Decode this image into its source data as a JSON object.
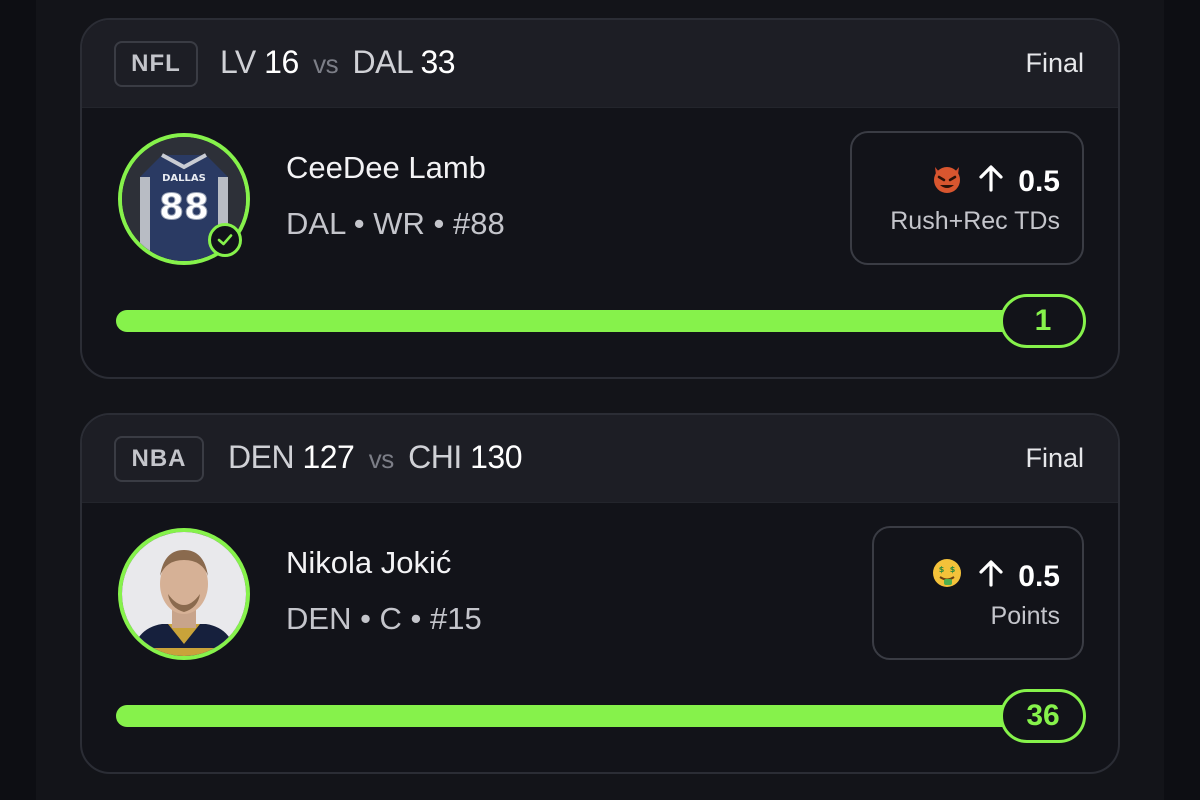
{
  "colors": {
    "accent": "#86f24b",
    "background": "#0d0e13",
    "card": "#121319",
    "header": "#1d1e25"
  },
  "cards": [
    {
      "league": "NFL",
      "team1": "LV",
      "score1": "16",
      "vs": "vs",
      "team2": "DAL",
      "score2": "33",
      "status": "Final",
      "player_name": "CeeDee Lamb",
      "player_meta": "DAL • WR • #88",
      "avatar_icon": "jersey-88-photo",
      "verified_icon": "check-circle-icon",
      "pick_emoji_icon": "devil-face-emoji",
      "pick_direction_icon": "arrow-up-icon",
      "pick_line": "0.5",
      "pick_stat": "Rush+Rec TDs",
      "progress_fraction": 1.0,
      "result": "1"
    },
    {
      "league": "NBA",
      "team1": "DEN",
      "score1": "127",
      "vs": "vs",
      "team2": "CHI",
      "score2": "130",
      "status": "Final",
      "player_name": "Nikola Jokić",
      "player_meta": "DEN • C • #15",
      "avatar_icon": "player-headshot-photo",
      "pick_emoji_icon": "money-mouth-emoji",
      "pick_direction_icon": "arrow-up-icon",
      "pick_line": "0.5",
      "pick_stat": "Points",
      "progress_fraction": 1.0,
      "result": "36"
    }
  ]
}
